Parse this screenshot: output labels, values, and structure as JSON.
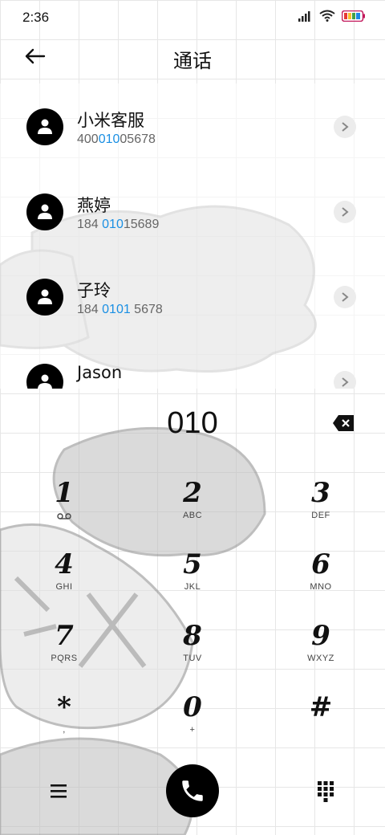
{
  "status": {
    "time": "2:36"
  },
  "header": {
    "title": "通话"
  },
  "contacts": [
    {
      "name": "小米客服",
      "num_pre": "400",
      "num_hl": "010",
      "num_post": "05678"
    },
    {
      "name": "燕婷",
      "num_pre": "184 ",
      "num_hl": "010",
      "num_post": "15689"
    },
    {
      "name": "子玲",
      "num_pre": "184 ",
      "num_hl": "0101",
      "num_post": " 5678"
    },
    {
      "name": "Jason",
      "num_pre": "",
      "num_hl": "",
      "num_post": ""
    }
  ],
  "dialer": {
    "display": "010",
    "keys": [
      {
        "digit": "1",
        "letters": "",
        "icon": "voicemail-icon"
      },
      {
        "digit": "2",
        "letters": "ABC"
      },
      {
        "digit": "3",
        "letters": "DEF"
      },
      {
        "digit": "4",
        "letters": "GHI"
      },
      {
        "digit": "5",
        "letters": "JKL"
      },
      {
        "digit": "6",
        "letters": "MNO"
      },
      {
        "digit": "7",
        "letters": "PQRS"
      },
      {
        "digit": "8",
        "letters": "TUV"
      },
      {
        "digit": "9",
        "letters": "WXYZ"
      },
      {
        "digit": "*",
        "letters": ","
      },
      {
        "digit": "0",
        "letters": "+"
      },
      {
        "digit": "#",
        "letters": ""
      }
    ]
  },
  "icons": {
    "back": "arrow-left-icon",
    "avatar": "person-icon",
    "chevron": "chevron-right-icon",
    "backspace": "backspace-icon",
    "menu": "menu-icon",
    "call": "phone-icon",
    "dialpad": "dialpad-icon"
  },
  "colors": {
    "highlight": "#1a8fe3",
    "accent": "#000000",
    "battery": "#c2185b"
  }
}
